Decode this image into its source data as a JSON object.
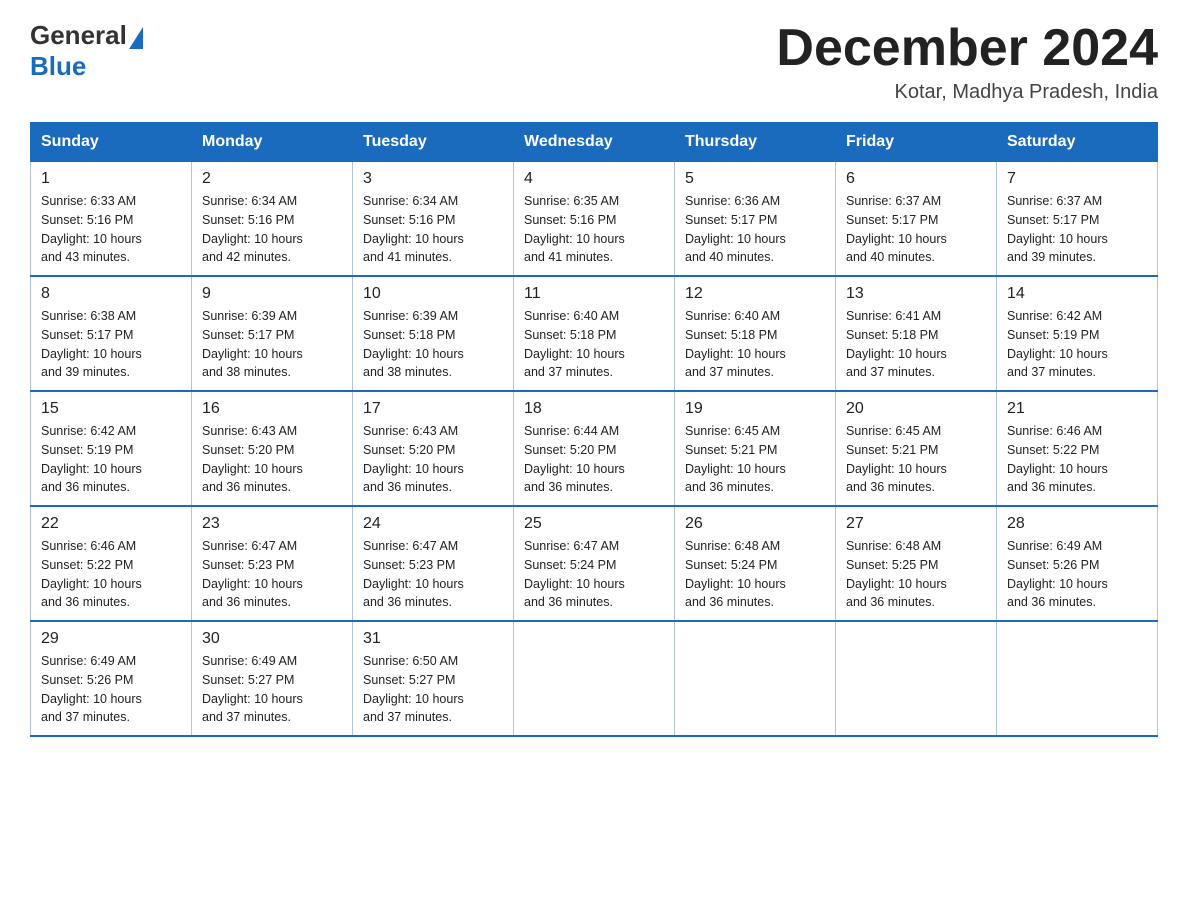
{
  "header": {
    "logo_general": "General",
    "logo_blue": "Blue",
    "title": "December 2024",
    "subtitle": "Kotar, Madhya Pradesh, India"
  },
  "weekdays": [
    "Sunday",
    "Monday",
    "Tuesday",
    "Wednesday",
    "Thursday",
    "Friday",
    "Saturday"
  ],
  "weeks": [
    [
      {
        "day": "1",
        "sunrise": "6:33 AM",
        "sunset": "5:16 PM",
        "daylight": "10 hours and 43 minutes."
      },
      {
        "day": "2",
        "sunrise": "6:34 AM",
        "sunset": "5:16 PM",
        "daylight": "10 hours and 42 minutes."
      },
      {
        "day": "3",
        "sunrise": "6:34 AM",
        "sunset": "5:16 PM",
        "daylight": "10 hours and 41 minutes."
      },
      {
        "day": "4",
        "sunrise": "6:35 AM",
        "sunset": "5:16 PM",
        "daylight": "10 hours and 41 minutes."
      },
      {
        "day": "5",
        "sunrise": "6:36 AM",
        "sunset": "5:17 PM",
        "daylight": "10 hours and 40 minutes."
      },
      {
        "day": "6",
        "sunrise": "6:37 AM",
        "sunset": "5:17 PM",
        "daylight": "10 hours and 40 minutes."
      },
      {
        "day": "7",
        "sunrise": "6:37 AM",
        "sunset": "5:17 PM",
        "daylight": "10 hours and 39 minutes."
      }
    ],
    [
      {
        "day": "8",
        "sunrise": "6:38 AM",
        "sunset": "5:17 PM",
        "daylight": "10 hours and 39 minutes."
      },
      {
        "day": "9",
        "sunrise": "6:39 AM",
        "sunset": "5:17 PM",
        "daylight": "10 hours and 38 minutes."
      },
      {
        "day": "10",
        "sunrise": "6:39 AM",
        "sunset": "5:18 PM",
        "daylight": "10 hours and 38 minutes."
      },
      {
        "day": "11",
        "sunrise": "6:40 AM",
        "sunset": "5:18 PM",
        "daylight": "10 hours and 37 minutes."
      },
      {
        "day": "12",
        "sunrise": "6:40 AM",
        "sunset": "5:18 PM",
        "daylight": "10 hours and 37 minutes."
      },
      {
        "day": "13",
        "sunrise": "6:41 AM",
        "sunset": "5:18 PM",
        "daylight": "10 hours and 37 minutes."
      },
      {
        "day": "14",
        "sunrise": "6:42 AM",
        "sunset": "5:19 PM",
        "daylight": "10 hours and 37 minutes."
      }
    ],
    [
      {
        "day": "15",
        "sunrise": "6:42 AM",
        "sunset": "5:19 PM",
        "daylight": "10 hours and 36 minutes."
      },
      {
        "day": "16",
        "sunrise": "6:43 AM",
        "sunset": "5:20 PM",
        "daylight": "10 hours and 36 minutes."
      },
      {
        "day": "17",
        "sunrise": "6:43 AM",
        "sunset": "5:20 PM",
        "daylight": "10 hours and 36 minutes."
      },
      {
        "day": "18",
        "sunrise": "6:44 AM",
        "sunset": "5:20 PM",
        "daylight": "10 hours and 36 minutes."
      },
      {
        "day": "19",
        "sunrise": "6:45 AM",
        "sunset": "5:21 PM",
        "daylight": "10 hours and 36 minutes."
      },
      {
        "day": "20",
        "sunrise": "6:45 AM",
        "sunset": "5:21 PM",
        "daylight": "10 hours and 36 minutes."
      },
      {
        "day": "21",
        "sunrise": "6:46 AM",
        "sunset": "5:22 PM",
        "daylight": "10 hours and 36 minutes."
      }
    ],
    [
      {
        "day": "22",
        "sunrise": "6:46 AM",
        "sunset": "5:22 PM",
        "daylight": "10 hours and 36 minutes."
      },
      {
        "day": "23",
        "sunrise": "6:47 AM",
        "sunset": "5:23 PM",
        "daylight": "10 hours and 36 minutes."
      },
      {
        "day": "24",
        "sunrise": "6:47 AM",
        "sunset": "5:23 PM",
        "daylight": "10 hours and 36 minutes."
      },
      {
        "day": "25",
        "sunrise": "6:47 AM",
        "sunset": "5:24 PM",
        "daylight": "10 hours and 36 minutes."
      },
      {
        "day": "26",
        "sunrise": "6:48 AM",
        "sunset": "5:24 PM",
        "daylight": "10 hours and 36 minutes."
      },
      {
        "day": "27",
        "sunrise": "6:48 AM",
        "sunset": "5:25 PM",
        "daylight": "10 hours and 36 minutes."
      },
      {
        "day": "28",
        "sunrise": "6:49 AM",
        "sunset": "5:26 PM",
        "daylight": "10 hours and 36 minutes."
      }
    ],
    [
      {
        "day": "29",
        "sunrise": "6:49 AM",
        "sunset": "5:26 PM",
        "daylight": "10 hours and 37 minutes."
      },
      {
        "day": "30",
        "sunrise": "6:49 AM",
        "sunset": "5:27 PM",
        "daylight": "10 hours and 37 minutes."
      },
      {
        "day": "31",
        "sunrise": "6:50 AM",
        "sunset": "5:27 PM",
        "daylight": "10 hours and 37 minutes."
      },
      null,
      null,
      null,
      null
    ]
  ],
  "labels": {
    "sunrise": "Sunrise:",
    "sunset": "Sunset:",
    "daylight": "Daylight:"
  }
}
